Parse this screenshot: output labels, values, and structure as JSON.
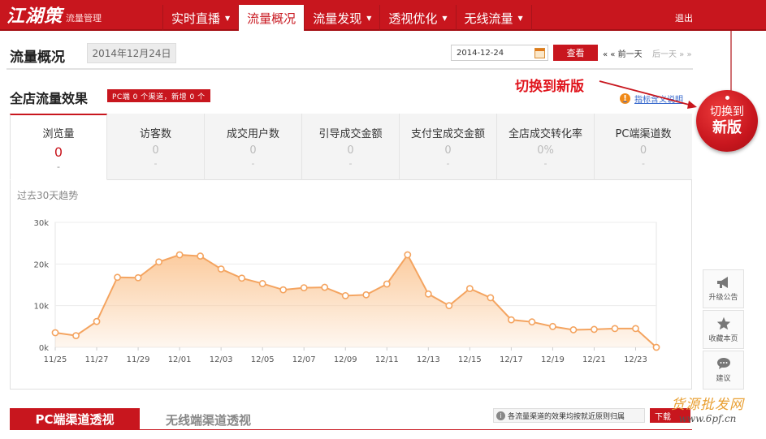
{
  "header": {
    "logo_text": "江湖策",
    "logo_sub": "流量管理",
    "nav": [
      {
        "label": "实时直播",
        "caret": "▼"
      },
      {
        "label": "流量概况",
        "caret": ""
      },
      {
        "label": "流量发现",
        "caret": "▼"
      },
      {
        "label": "透视优化",
        "caret": "▼"
      },
      {
        "label": "无线流量",
        "caret": "▼"
      }
    ],
    "logout": "退出"
  },
  "page": {
    "title": "流量概况",
    "date_display": "2014年12月24日",
    "date_input": "2014-12-24",
    "view_button": "查看",
    "prev_day": "« « 前一天",
    "next_day": "后一天 » »"
  },
  "section": {
    "title": "全店流量效果",
    "tag": "PC端 0 个渠道，新增 0 个",
    "metric_help": "指标含义说明",
    "switch_note": "切换到新版",
    "switch_circle_l1": "切换到",
    "switch_circle_l2": "新版"
  },
  "tabs": [
    {
      "label": "浏览量",
      "value": "0",
      "delta": "-"
    },
    {
      "label": "访客数",
      "value": "0",
      "delta": "-"
    },
    {
      "label": "成交用户数",
      "value": "0",
      "delta": "-"
    },
    {
      "label": "引导成交金额",
      "value": "0",
      "delta": "-"
    },
    {
      "label": "支付宝成交金额",
      "value": "0",
      "delta": "-"
    },
    {
      "label": "全店成交转化率",
      "value": "0%",
      "delta": "-"
    },
    {
      "label": "PC端渠道数",
      "value": "0",
      "delta": "-"
    }
  ],
  "chart_data": {
    "type": "area",
    "title": "过去30天趋势",
    "xlabel": "",
    "ylabel": "",
    "x": [
      "11/25",
      "11/26",
      "11/27",
      "11/28",
      "11/29",
      "11/30",
      "12/01",
      "12/02",
      "12/03",
      "12/04",
      "12/05",
      "12/06",
      "12/07",
      "12/08",
      "12/09",
      "12/10",
      "12/11",
      "12/12",
      "12/13",
      "12/14",
      "12/15",
      "12/16",
      "12/17",
      "12/18",
      "12/19",
      "12/20",
      "12/21",
      "12/22",
      "12/23",
      "12/24"
    ],
    "tick_labels": [
      "11/25",
      "11/27",
      "11/29",
      "12/01",
      "12/03",
      "12/05",
      "12/07",
      "12/09",
      "12/11",
      "12/13",
      "12/15",
      "12/17",
      "12/19",
      "12/21",
      "12/23"
    ],
    "y_ticks": [
      "0k",
      "10k",
      "20k",
      "30k"
    ],
    "ylim": [
      0,
      30000
    ],
    "grid": true,
    "series": [
      {
        "values": [
          3500,
          2800,
          6200,
          16800,
          16700,
          20500,
          22200,
          21900,
          18800,
          16600,
          15300,
          13800,
          14300,
          14400,
          12400,
          12600,
          15200,
          22200,
          12800,
          10000,
          14100,
          11900,
          6600,
          6100,
          5000,
          4200,
          4300,
          4500,
          4500,
          0
        ]
      }
    ],
    "line_color": "#f4a460",
    "fill_color": "#fbc99a"
  },
  "tools": [
    {
      "icon": "megaphone-icon",
      "label": "升级公告"
    },
    {
      "icon": "star-icon",
      "label": "收藏本页"
    },
    {
      "icon": "comment-icon",
      "label": "建议"
    }
  ],
  "bottom": {
    "tab_pc": "PC端渠道透视",
    "tab_wireless": "无线端渠道透视",
    "notice": "各流量渠道的效果均按就近原则归属",
    "download": "下载",
    "watermark_1": "货源批发网",
    "watermark_2": "www.6pf.cn"
  },
  "colors": {
    "brand": "#c8161e",
    "accent": "#f4a460"
  }
}
